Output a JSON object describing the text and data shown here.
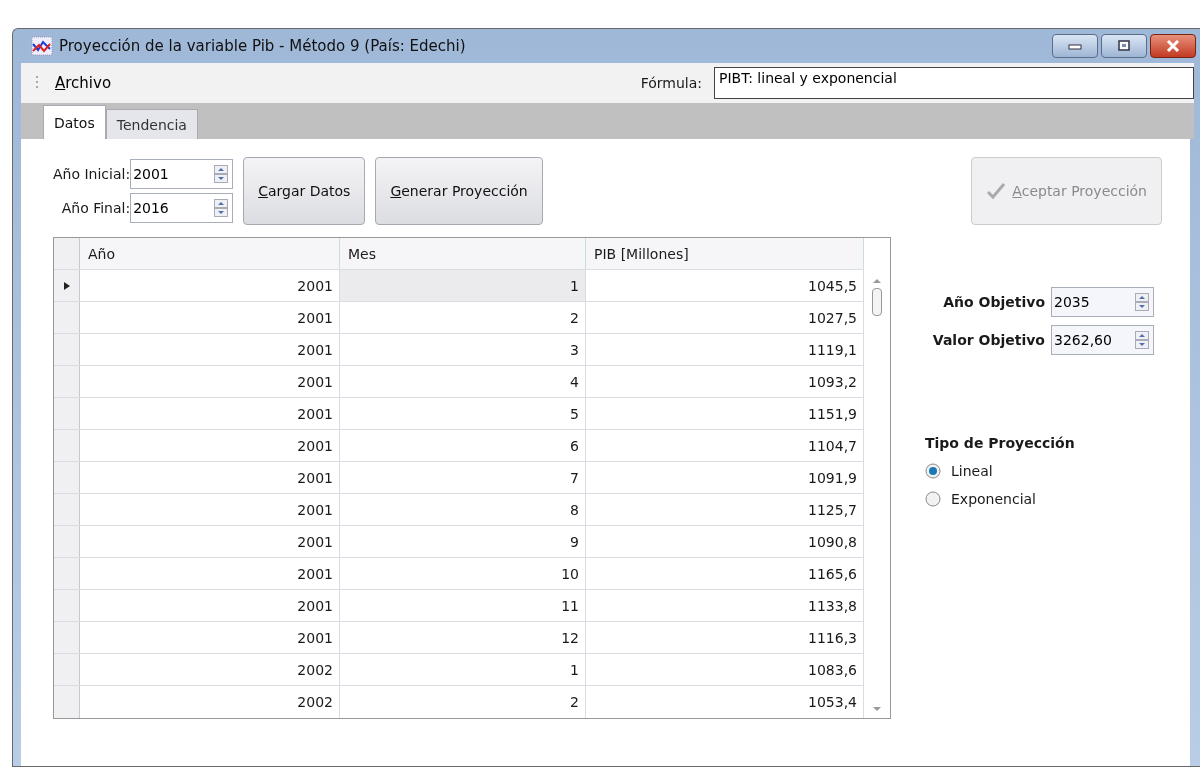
{
  "window": {
    "title": "Proyección de la variable Pib - Método 9 (País: Edechi)"
  },
  "menu": [
    {
      "label": "Archivo"
    }
  ],
  "formula": {
    "label": "Fórmula:",
    "value": "PIBT: lineal y exponencial"
  },
  "tabs": [
    {
      "label": "Datos",
      "selected": true
    },
    {
      "label": "Tendencia",
      "selected": false
    }
  ],
  "range_fields": [
    {
      "label": "Año Inicial:",
      "value": "2001"
    },
    {
      "label": "Año Final:",
      "value": "2016"
    }
  ],
  "buttons": [
    {
      "label": "Cargar Datos",
      "disabled": false
    },
    {
      "label": "Generar Proyección",
      "disabled": false
    }
  ],
  "accept_button": {
    "label": "Aceptar Proyección",
    "disabled": true
  },
  "table": {
    "columns": [
      "Año",
      "Mes",
      "PIB [Millones]"
    ],
    "rows": [
      {
        "cells": [
          "2001",
          "1",
          "1045,5"
        ],
        "selected": true
      },
      {
        "cells": [
          "2001",
          "2",
          "1027,5"
        ],
        "selected": false
      },
      {
        "cells": [
          "2001",
          "3",
          "1119,1"
        ],
        "selected": false
      },
      {
        "cells": [
          "2001",
          "4",
          "1093,2"
        ],
        "selected": false
      },
      {
        "cells": [
          "2001",
          "5",
          "1151,9"
        ],
        "selected": false
      },
      {
        "cells": [
          "2001",
          "6",
          "1104,7"
        ],
        "selected": false
      },
      {
        "cells": [
          "2001",
          "7",
          "1091,9"
        ],
        "selected": false
      },
      {
        "cells": [
          "2001",
          "8",
          "1125,7"
        ],
        "selected": false
      },
      {
        "cells": [
          "2001",
          "9",
          "1090,8"
        ],
        "selected": false
      },
      {
        "cells": [
          "2001",
          "10",
          "1165,6"
        ],
        "selected": false
      },
      {
        "cells": [
          "2001",
          "11",
          "1133,8"
        ],
        "selected": false
      },
      {
        "cells": [
          "2001",
          "12",
          "1116,3"
        ],
        "selected": false
      },
      {
        "cells": [
          "2002",
          "1",
          "1083,6"
        ],
        "selected": false
      },
      {
        "cells": [
          "2002",
          "2",
          "1053,4"
        ],
        "selected": false
      }
    ]
  },
  "target_fields": [
    {
      "label": "Año Objetivo",
      "value": "2035"
    },
    {
      "label": "Valor Objetivo",
      "value": "3262,60"
    }
  ],
  "projection_type": {
    "title": "Tipo de Proyección",
    "options": [
      {
        "label": "Lineal",
        "selected": true
      },
      {
        "label": "Exponencial",
        "selected": false
      }
    ]
  }
}
